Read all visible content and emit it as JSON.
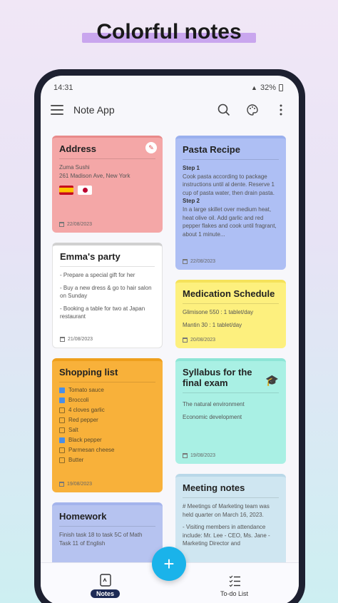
{
  "headline": "Colorful notes",
  "status": {
    "time": "14:31",
    "battery": "32%"
  },
  "appbar": {
    "title": "Note App"
  },
  "notes": {
    "address": {
      "title": "Address",
      "line1": "Zuma Sushi",
      "line2": "261 Madison Ave, New York",
      "date": "22/08/2023"
    },
    "party": {
      "title": "Emma's party",
      "items": [
        "- Prepare a special gift for her",
        "- Buy a new dress & go to hair salon on Sunday",
        "- Booking a table for two at Japan restaurant"
      ],
      "date": "21/08/2023"
    },
    "shopping": {
      "title": "Shopping list",
      "items": [
        {
          "label": "Tomato sauce",
          "checked": true
        },
        {
          "label": "Broccoli",
          "checked": true
        },
        {
          "label": "4 cloves garlic",
          "checked": false
        },
        {
          "label": "Red pepper",
          "checked": false
        },
        {
          "label": "Salt",
          "checked": false
        },
        {
          "label": "Black pepper",
          "checked": true
        },
        {
          "label": "Parmesan cheese",
          "checked": false
        },
        {
          "label": "Butter",
          "checked": false
        }
      ],
      "date": "19/08/2023"
    },
    "homework": {
      "title": "Homework",
      "text": "Finish task 18 to task 5C of Math Task 11 of English"
    },
    "pasta": {
      "title": "Pasta Recipe",
      "step1": "Step 1",
      "text1": "Cook pasta according to package instructions until al dente. Reserve 1 cup of pasta water, then drain pasta.",
      "step2": "Step 2",
      "text2": "In a large skillet over medium heat, heat olive oil. Add garlic and red pepper flakes and cook until fragrant, about 1 minute...",
      "date": "22/08/2023"
    },
    "medication": {
      "title": "Medication Schedule",
      "items": [
        "Glimisone 550 : 1 tablet/day",
        "Mantin 30 : 1 tablet/day"
      ],
      "date": "20/08/2023"
    },
    "syllabus": {
      "title": "Syllabus for the final exam",
      "items": [
        "The natural environment",
        "Economic development"
      ],
      "date": "19/08/2023"
    },
    "meeting": {
      "title": "Meeting notes",
      "p1": "# Meetings of Marketing team was held quarter on March 16, 2023.",
      "p2": "- Visiting members in attendance include: Mr. Lee - CEO, Ms. Jane - Marketing Director and"
    }
  },
  "nav": {
    "notes_label": "Notes",
    "todo_label": "To-do List"
  },
  "fab_label": "+"
}
